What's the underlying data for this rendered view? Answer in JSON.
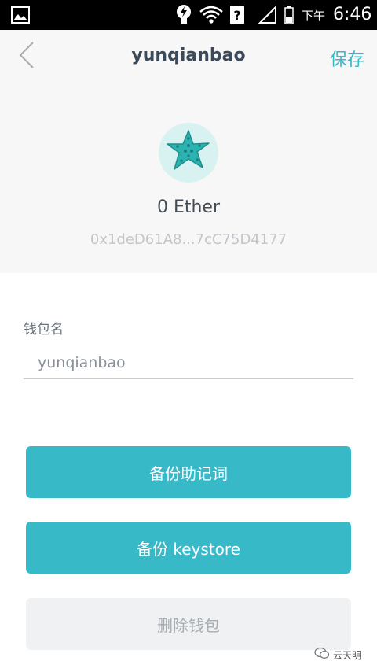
{
  "status_bar": {
    "icons": [
      "gallery-icon",
      "lightbulb-icon",
      "wifi-icon",
      "question-icon",
      "signal-icon",
      "battery-icon"
    ],
    "ampm": "下午",
    "time": "6:46"
  },
  "nav": {
    "back_icon": "chevron-left-icon",
    "title": "yunqianbao",
    "save_label": "保存"
  },
  "wallet": {
    "avatar_icon": "starfish-icon",
    "balance": "0 Ether",
    "address": "0x1deD61A8...7cC75D4177"
  },
  "form": {
    "name_label": "钱包名",
    "name_value": "yunqianbao"
  },
  "actions": {
    "backup_mnemonic": "备份助记词",
    "backup_keystore": "备份 keystore",
    "delete_wallet": "删除钱包"
  },
  "watermark": {
    "text": "云天明"
  },
  "colors": {
    "accent": "#37b9c8",
    "header_bg": "#f7f7f7",
    "title": "#3a4a5a",
    "delete_bg": "#f0f1f3"
  }
}
